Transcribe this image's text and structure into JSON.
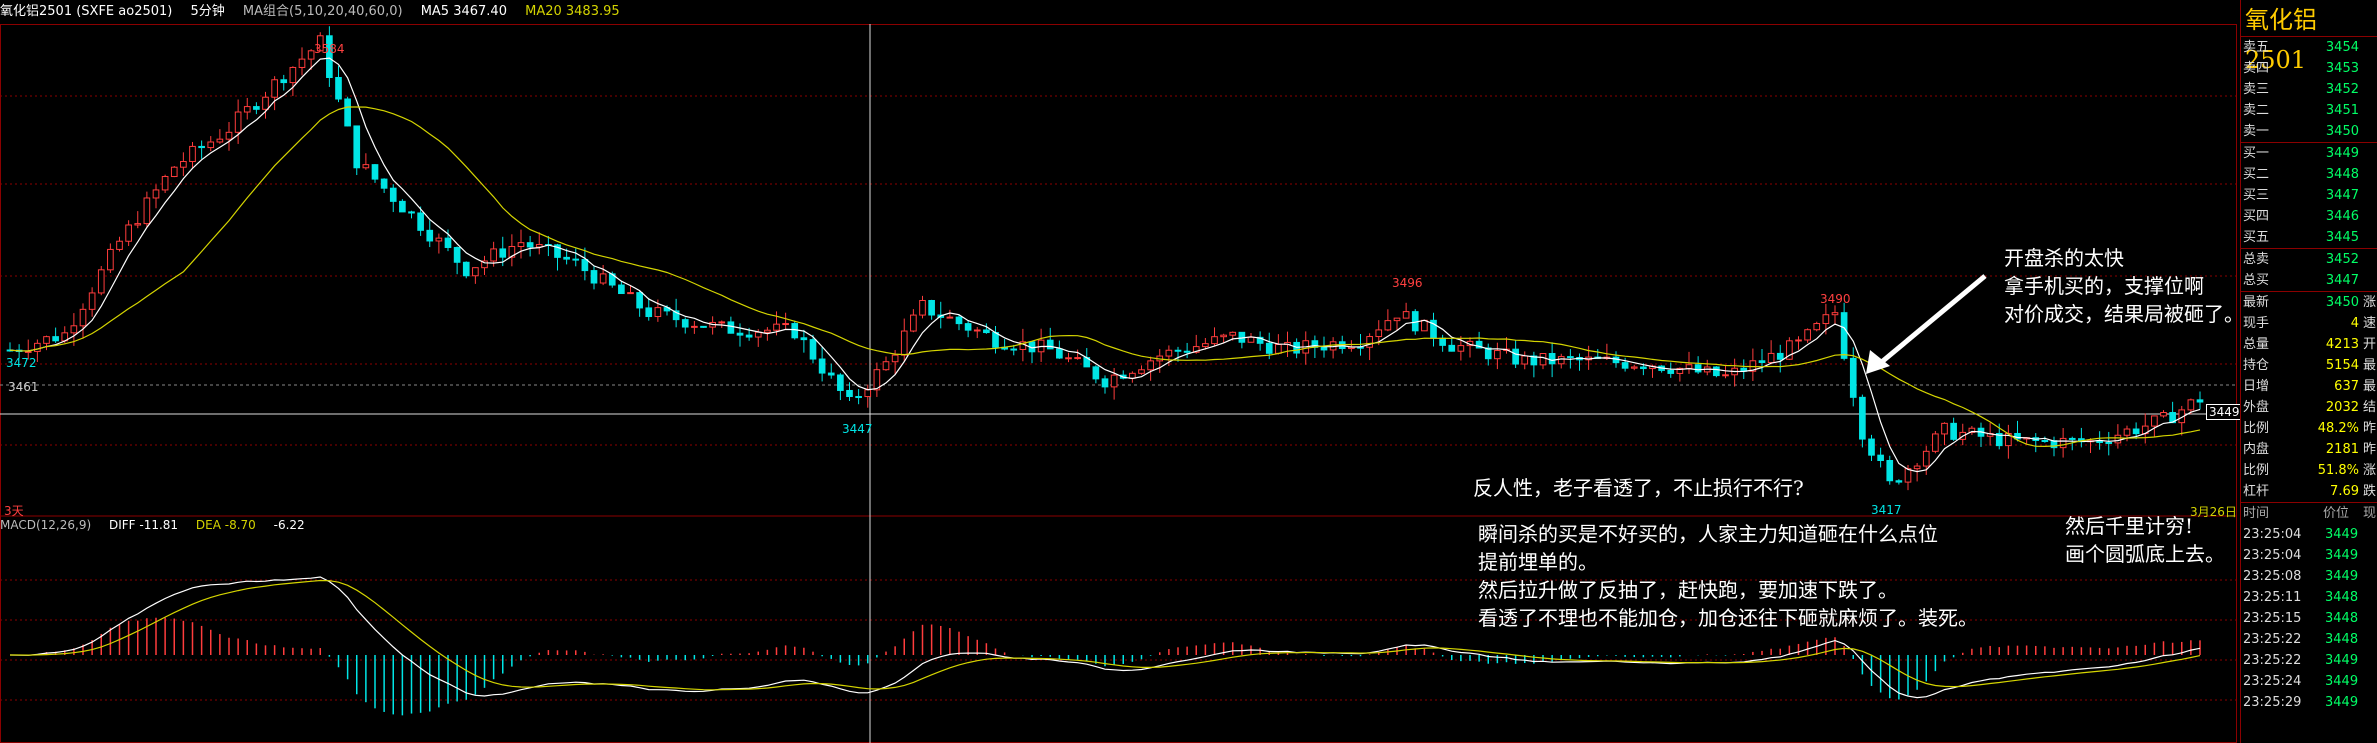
{
  "header": {
    "symbol": "氧化铝2501 (SXFE ao2501)",
    "timeframe": "5分钟",
    "ma_group": "MA组合(5,10,20,40,60,0)",
    "ma5": "MA5 3467.40",
    "ma20": "MA20 3483.95"
  },
  "price_labels": {
    "high": "3584",
    "peak2": "3496",
    "peak3": "3490",
    "low1": "3447",
    "low2": "3417",
    "start": "3472",
    "ref": "3461",
    "current": "3449",
    "left_bottom": "3天",
    "right_bottom": "3月26日"
  },
  "macd": {
    "title": "MACD(12,26,9)",
    "diff": "DIFF -11.81",
    "dea": "DEA -8.70",
    "macd": "-6.22"
  },
  "annotations": {
    "note1": "开盘杀的太快\n拿手机买的，支撑位啊\n对价成交，结果局被砸了。",
    "note2": "反人性，老子看透了，不止损行不行?",
    "note3": "瞬间杀的买是不好买的，人家主力知道砸在什么点位\n提前埋单的。\n然后拉升做了反抽了，赶快跑，要加速下跌了。\n看透了不理也不能加仓，加仓还往下砸就麻烦了。装死。",
    "note4": "然后千里计穷!\n画个圆弧底上去。"
  },
  "panel": {
    "title": "氧化铝2501",
    "asks": [
      {
        "label": "卖五",
        "price": "3454",
        "vol": ""
      },
      {
        "label": "卖四",
        "price": "3453",
        "vol": ""
      },
      {
        "label": "卖三",
        "price": "3452",
        "vol": ""
      },
      {
        "label": "卖二",
        "price": "3451",
        "vol": ""
      },
      {
        "label": "卖一",
        "price": "3450",
        "vol": ""
      }
    ],
    "bids": [
      {
        "label": "买一",
        "price": "3449",
        "vol": ""
      },
      {
        "label": "买二",
        "price": "3448",
        "vol": ""
      },
      {
        "label": "买三",
        "price": "3447",
        "vol": ""
      },
      {
        "label": "买四",
        "price": "3446",
        "vol": ""
      },
      {
        "label": "买五",
        "price": "3445",
        "vol": ""
      }
    ],
    "totals": [
      {
        "label": "总卖",
        "value": "3452"
      },
      {
        "label": "总买",
        "value": "3447"
      }
    ],
    "stats": [
      {
        "label": "最新",
        "value": "3450",
        "tail": "涨"
      },
      {
        "label": "现手",
        "value": "4",
        "tail": "速"
      },
      {
        "label": "总量",
        "value": "4213",
        "tail": "开"
      },
      {
        "label": "持仓",
        "value": "5154",
        "tail": "最"
      },
      {
        "label": "日增",
        "value": "637",
        "tail": "最"
      },
      {
        "label": "外盘",
        "value": "2032",
        "tail": "结"
      },
      {
        "label": "比例",
        "value": "48.2%",
        "tail": "昨"
      },
      {
        "label": "内盘",
        "value": "2181",
        "tail": "昨"
      },
      {
        "label": "比例",
        "value": "51.8%",
        "tail": "涨"
      },
      {
        "label": "杠杆",
        "value": "7.69",
        "tail": "跌"
      }
    ],
    "ticks_header": {
      "time": "时间",
      "price": "价位",
      "extra": "现"
    },
    "ticks": [
      {
        "time": "23:25:04",
        "price": "3449"
      },
      {
        "time": "23:25:04",
        "price": "3449"
      },
      {
        "time": "23:25:08",
        "price": "3449"
      },
      {
        "time": "23:25:11",
        "price": "3448"
      },
      {
        "time": "23:25:15",
        "price": "3448"
      },
      {
        "time": "23:25:22",
        "price": "3448"
      },
      {
        "time": "23:25:22",
        "price": "3449"
      },
      {
        "time": "23:25:24",
        "price": "3449"
      },
      {
        "time": "23:25:29",
        "price": "3449"
      }
    ]
  },
  "colors": {
    "up": "#ff3c3c",
    "down": "#00e5e5",
    "ma_white": "#ffffff",
    "ma_yellow": "#d4d400",
    "grid": "#8b0000"
  },
  "chart_data": {
    "type": "candlestick",
    "price_range": [
      3410,
      3590
    ],
    "trend_anchors": [
      [
        0,
        3470
      ],
      [
        6,
        3476
      ],
      [
        12,
        3510
      ],
      [
        18,
        3538
      ],
      [
        24,
        3552
      ],
      [
        30,
        3572
      ],
      [
        34,
        3584
      ],
      [
        38,
        3540
      ],
      [
        44,
        3520
      ],
      [
        50,
        3500
      ],
      [
        56,
        3510
      ],
      [
        62,
        3502
      ],
      [
        70,
        3484
      ],
      [
        78,
        3478
      ],
      [
        86,
        3477
      ],
      [
        92,
        3450
      ],
      [
        96,
        3465
      ],
      [
        100,
        3486
      ],
      [
        108,
        3474
      ],
      [
        114,
        3470
      ],
      [
        120,
        3459
      ],
      [
        126,
        3468
      ],
      [
        134,
        3475
      ],
      [
        140,
        3470
      ],
      [
        148,
        3474
      ],
      [
        152,
        3484
      ],
      [
        158,
        3472
      ],
      [
        166,
        3466
      ],
      [
        172,
        3466
      ],
      [
        180,
        3465
      ],
      [
        188,
        3460
      ],
      [
        196,
        3472
      ],
      [
        200,
        3484
      ],
      [
        203,
        3440
      ],
      [
        206,
        3420
      ],
      [
        212,
        3440
      ],
      [
        220,
        3436
      ],
      [
        228,
        3436
      ],
      [
        236,
        3444
      ],
      [
        240,
        3452
      ]
    ]
  }
}
